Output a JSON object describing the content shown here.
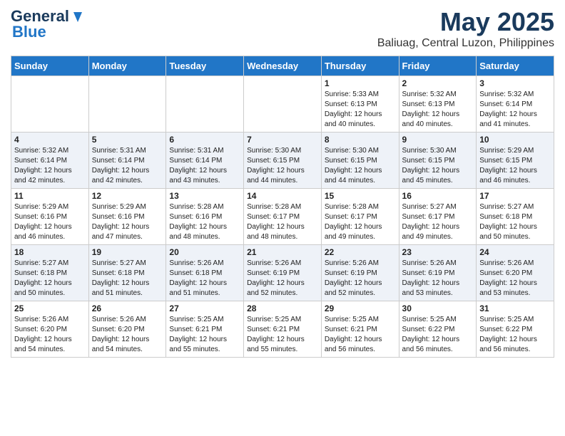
{
  "logo": {
    "general": "General",
    "blue": "Blue"
  },
  "title": "May 2025",
  "location": "Baliuag, Central Luzon, Philippines",
  "days_header": [
    "Sunday",
    "Monday",
    "Tuesday",
    "Wednesday",
    "Thursday",
    "Friday",
    "Saturday"
  ],
  "weeks": [
    {
      "alt": false,
      "days": [
        {
          "num": "",
          "info": ""
        },
        {
          "num": "",
          "info": ""
        },
        {
          "num": "",
          "info": ""
        },
        {
          "num": "",
          "info": ""
        },
        {
          "num": "1",
          "info": "Sunrise: 5:33 AM\nSunset: 6:13 PM\nDaylight: 12 hours\nand 40 minutes."
        },
        {
          "num": "2",
          "info": "Sunrise: 5:32 AM\nSunset: 6:13 PM\nDaylight: 12 hours\nand 40 minutes."
        },
        {
          "num": "3",
          "info": "Sunrise: 5:32 AM\nSunset: 6:14 PM\nDaylight: 12 hours\nand 41 minutes."
        }
      ]
    },
    {
      "alt": true,
      "days": [
        {
          "num": "4",
          "info": "Sunrise: 5:32 AM\nSunset: 6:14 PM\nDaylight: 12 hours\nand 42 minutes."
        },
        {
          "num": "5",
          "info": "Sunrise: 5:31 AM\nSunset: 6:14 PM\nDaylight: 12 hours\nand 42 minutes."
        },
        {
          "num": "6",
          "info": "Sunrise: 5:31 AM\nSunset: 6:14 PM\nDaylight: 12 hours\nand 43 minutes."
        },
        {
          "num": "7",
          "info": "Sunrise: 5:30 AM\nSunset: 6:15 PM\nDaylight: 12 hours\nand 44 minutes."
        },
        {
          "num": "8",
          "info": "Sunrise: 5:30 AM\nSunset: 6:15 PM\nDaylight: 12 hours\nand 44 minutes."
        },
        {
          "num": "9",
          "info": "Sunrise: 5:30 AM\nSunset: 6:15 PM\nDaylight: 12 hours\nand 45 minutes."
        },
        {
          "num": "10",
          "info": "Sunrise: 5:29 AM\nSunset: 6:15 PM\nDaylight: 12 hours\nand 46 minutes."
        }
      ]
    },
    {
      "alt": false,
      "days": [
        {
          "num": "11",
          "info": "Sunrise: 5:29 AM\nSunset: 6:16 PM\nDaylight: 12 hours\nand 46 minutes."
        },
        {
          "num": "12",
          "info": "Sunrise: 5:29 AM\nSunset: 6:16 PM\nDaylight: 12 hours\nand 47 minutes."
        },
        {
          "num": "13",
          "info": "Sunrise: 5:28 AM\nSunset: 6:16 PM\nDaylight: 12 hours\nand 48 minutes."
        },
        {
          "num": "14",
          "info": "Sunrise: 5:28 AM\nSunset: 6:17 PM\nDaylight: 12 hours\nand 48 minutes."
        },
        {
          "num": "15",
          "info": "Sunrise: 5:28 AM\nSunset: 6:17 PM\nDaylight: 12 hours\nand 49 minutes."
        },
        {
          "num": "16",
          "info": "Sunrise: 5:27 AM\nSunset: 6:17 PM\nDaylight: 12 hours\nand 49 minutes."
        },
        {
          "num": "17",
          "info": "Sunrise: 5:27 AM\nSunset: 6:18 PM\nDaylight: 12 hours\nand 50 minutes."
        }
      ]
    },
    {
      "alt": true,
      "days": [
        {
          "num": "18",
          "info": "Sunrise: 5:27 AM\nSunset: 6:18 PM\nDaylight: 12 hours\nand 50 minutes."
        },
        {
          "num": "19",
          "info": "Sunrise: 5:27 AM\nSunset: 6:18 PM\nDaylight: 12 hours\nand 51 minutes."
        },
        {
          "num": "20",
          "info": "Sunrise: 5:26 AM\nSunset: 6:18 PM\nDaylight: 12 hours\nand 51 minutes."
        },
        {
          "num": "21",
          "info": "Sunrise: 5:26 AM\nSunset: 6:19 PM\nDaylight: 12 hours\nand 52 minutes."
        },
        {
          "num": "22",
          "info": "Sunrise: 5:26 AM\nSunset: 6:19 PM\nDaylight: 12 hours\nand 52 minutes."
        },
        {
          "num": "23",
          "info": "Sunrise: 5:26 AM\nSunset: 6:19 PM\nDaylight: 12 hours\nand 53 minutes."
        },
        {
          "num": "24",
          "info": "Sunrise: 5:26 AM\nSunset: 6:20 PM\nDaylight: 12 hours\nand 53 minutes."
        }
      ]
    },
    {
      "alt": false,
      "days": [
        {
          "num": "25",
          "info": "Sunrise: 5:26 AM\nSunset: 6:20 PM\nDaylight: 12 hours\nand 54 minutes."
        },
        {
          "num": "26",
          "info": "Sunrise: 5:26 AM\nSunset: 6:20 PM\nDaylight: 12 hours\nand 54 minutes."
        },
        {
          "num": "27",
          "info": "Sunrise: 5:25 AM\nSunset: 6:21 PM\nDaylight: 12 hours\nand 55 minutes."
        },
        {
          "num": "28",
          "info": "Sunrise: 5:25 AM\nSunset: 6:21 PM\nDaylight: 12 hours\nand 55 minutes."
        },
        {
          "num": "29",
          "info": "Sunrise: 5:25 AM\nSunset: 6:21 PM\nDaylight: 12 hours\nand 56 minutes."
        },
        {
          "num": "30",
          "info": "Sunrise: 5:25 AM\nSunset: 6:22 PM\nDaylight: 12 hours\nand 56 minutes."
        },
        {
          "num": "31",
          "info": "Sunrise: 5:25 AM\nSunset: 6:22 PM\nDaylight: 12 hours\nand 56 minutes."
        }
      ]
    }
  ]
}
